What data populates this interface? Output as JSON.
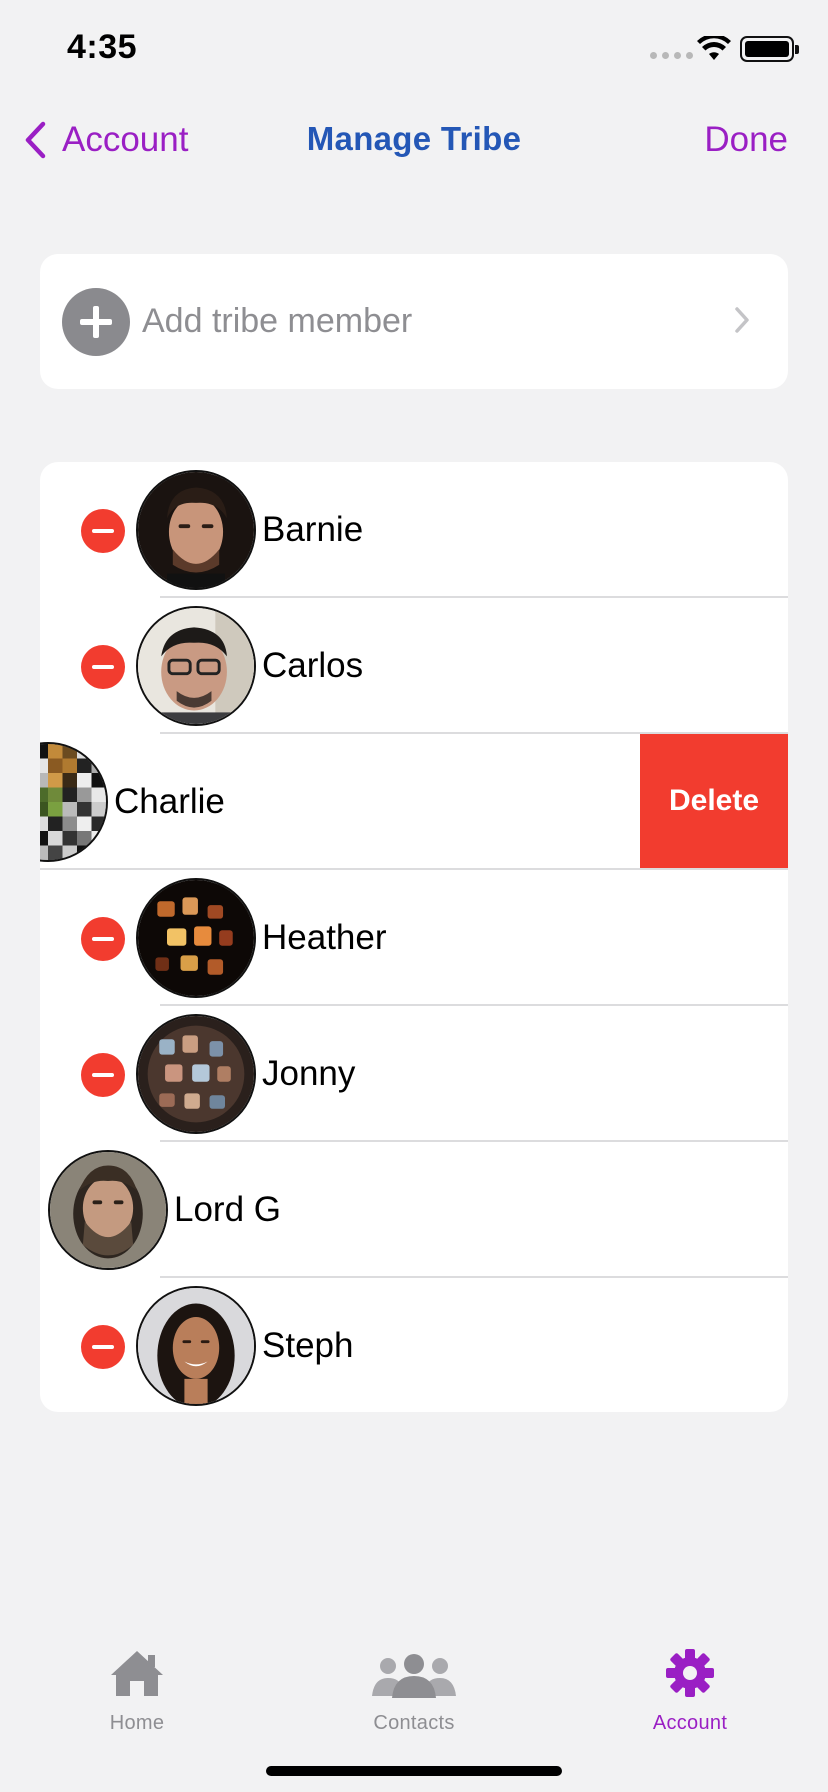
{
  "status_bar": {
    "time": "4:35"
  },
  "nav": {
    "back_label": "Account",
    "title": "Manage Tribe",
    "done_label": "Done",
    "accent_color": "#9a1fc4",
    "title_color": "#2457b6"
  },
  "add_member": {
    "label": "Add tribe member",
    "icon": "plus-circle-icon"
  },
  "members": [
    {
      "name": "Barnie",
      "state": "editing"
    },
    {
      "name": "Carlos",
      "state": "editing"
    },
    {
      "name": "Charlie",
      "state": "swiped"
    },
    {
      "name": "Heather",
      "state": "editing"
    },
    {
      "name": "Jonny",
      "state": "editing"
    },
    {
      "name": "Lord G",
      "state": "shifted"
    },
    {
      "name": "Steph",
      "state": "editing"
    }
  ],
  "delete_action": {
    "label": "Delete",
    "color": "#f23c2f"
  },
  "tabs": [
    {
      "label": "Home",
      "icon": "home-icon",
      "active": false
    },
    {
      "label": "Contacts",
      "icon": "contacts-icon",
      "active": false
    },
    {
      "label": "Account",
      "icon": "gear-icon",
      "active": true
    }
  ]
}
